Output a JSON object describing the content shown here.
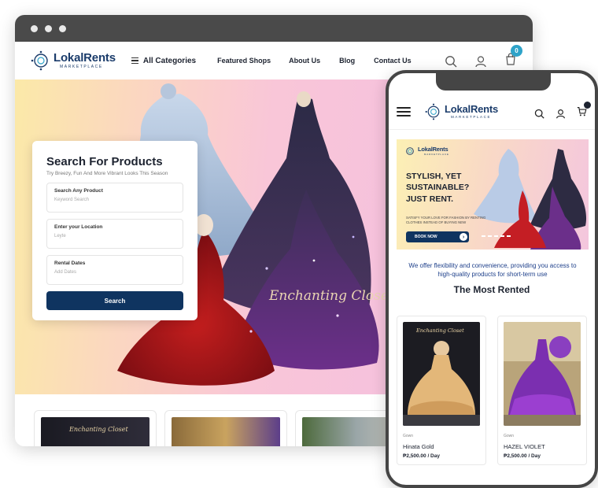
{
  "desktop": {
    "brand": {
      "name": "LokalRents",
      "subtitle": "MARKETPLACE"
    },
    "nav": {
      "categories_label": "All Categories",
      "links": [
        "Featured Shops",
        "About Us",
        "Blog",
        "Contact Us"
      ],
      "cart_count": "0"
    },
    "hero": {
      "shop_watermark": "Enchanting Closet"
    },
    "search": {
      "title": "Search For Products",
      "subtitle": "Try Breezy, Fun And More Vibrant Looks This Season",
      "fields": [
        {
          "label": "Search Any Product",
          "placeholder": "Keyword Search"
        },
        {
          "label": "Enter your Location",
          "placeholder": "Leyte"
        },
        {
          "label": "Rental Dates",
          "placeholder": "Add Dates"
        }
      ],
      "button_label": "Search"
    },
    "bottom_watermark": "Enchanting Closet"
  },
  "mobile": {
    "brand": {
      "name": "LokalRents",
      "subtitle": "MARKETPLACE"
    },
    "banner": {
      "headline": "STYLISH, YET\nSUSTAINABLE?\nJUST RENT.",
      "subline": "SATISFY YOUR LOVE FOR FASHION BY RENTING CLOTHES INSTEAD OF BUYING NEW",
      "button_label": "BOOK NOW"
    },
    "tagline": "We offer flexibility and convenience, providing you access to high-quality products for short-term use",
    "section_title": "The Most Rented",
    "products": [
      {
        "category": "Gown",
        "name": "Hinata Gold",
        "price": "₱2,500.00 / Day"
      },
      {
        "category": "Gown",
        "name": "HAZEL VIOLET",
        "price": "₱2,500.00 / Day"
      }
    ],
    "product_watermark": "Enchanting Closet"
  },
  "colors": {
    "navy": "#0f3460",
    "brand_blue": "#1b3c6b",
    "badge_teal": "#2ea3c9",
    "tagline_blue": "#1d3f8a"
  }
}
